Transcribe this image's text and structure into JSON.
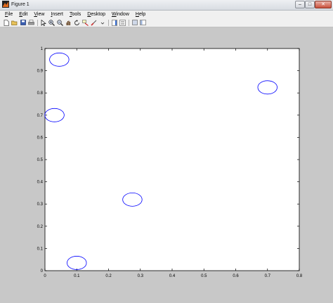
{
  "window": {
    "title": "Figure 1",
    "controls": [
      "–",
      "□",
      "✕"
    ]
  },
  "menubar": {
    "items": [
      {
        "label": "File"
      },
      {
        "label": "Edit"
      },
      {
        "label": "View"
      },
      {
        "label": "Insert"
      },
      {
        "label": "Tools"
      },
      {
        "label": "Desktop"
      },
      {
        "label": "Window"
      },
      {
        "label": "Help"
      }
    ]
  },
  "toolbar": {
    "icons": [
      "new-figure-icon",
      "open-file-icon",
      "save-icon",
      "print-icon",
      "pointer-icon",
      "zoom-in-icon",
      "zoom-out-icon",
      "pan-icon",
      "rotate-icon",
      "data-cursor-icon",
      "brush-icon",
      "link-icon",
      "colorbar-icon",
      "legend-icon",
      "hide-plot-tools-icon",
      "show-plot-tools-icon"
    ]
  },
  "chart_data": {
    "type": "scatter",
    "marker": "circle-outline",
    "color": "#0000ff",
    "xlim": [
      0,
      0.8
    ],
    "ylim": [
      0,
      1
    ],
    "xticks": [
      "0",
      "0.1",
      "0.2",
      "0.3",
      "0.4",
      "0.5",
      "0.6",
      "0.7",
      "0.8"
    ],
    "yticks": [
      "0",
      "0.1",
      "0.2",
      "0.3",
      "0.4",
      "0.5",
      "0.6",
      "0.7",
      "0.8",
      "0.9",
      "1"
    ],
    "circles": [
      {
        "x": 0.045,
        "y": 0.95,
        "r": 0.07
      },
      {
        "x": 0.03,
        "y": 0.7,
        "r": 0.07
      },
      {
        "x": 0.7,
        "y": 0.825,
        "r": 0.07
      },
      {
        "x": 0.275,
        "y": 0.32,
        "r": 0.07
      },
      {
        "x": 0.1,
        "y": 0.035,
        "r": 0.07
      }
    ]
  }
}
